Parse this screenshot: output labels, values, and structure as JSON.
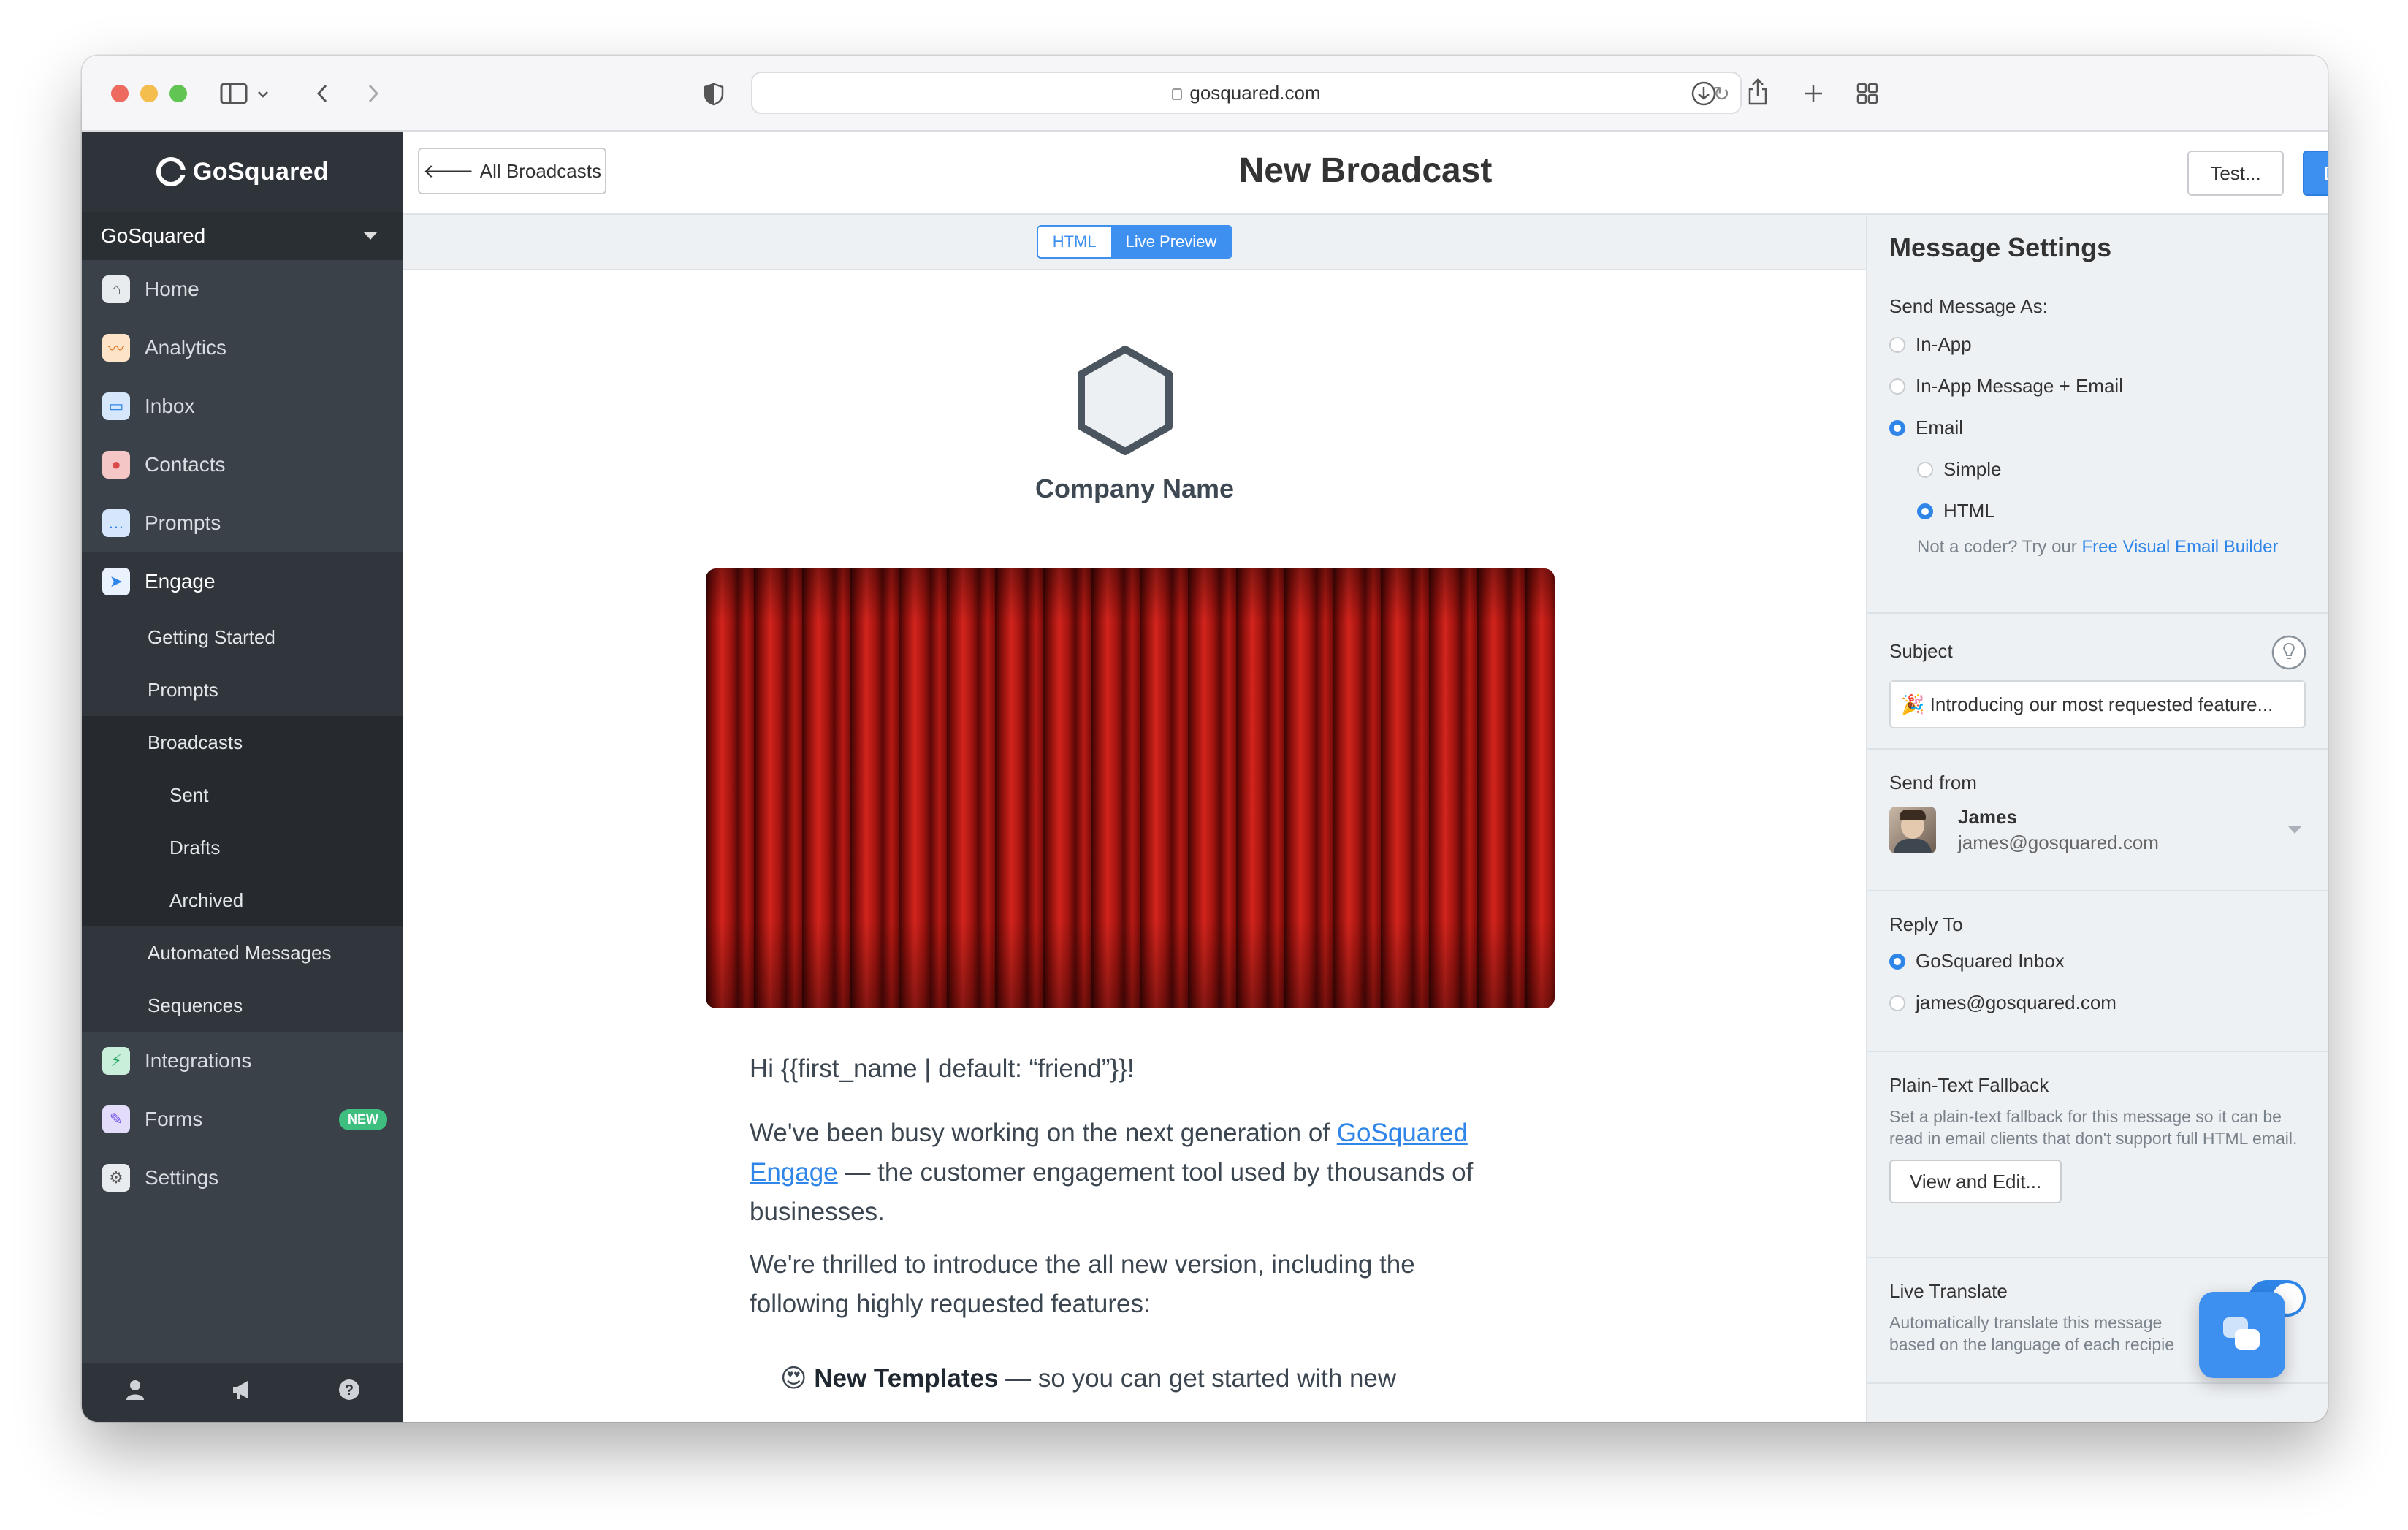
{
  "browser": {
    "url": "gosquared.com"
  },
  "sidebar": {
    "brand": "GoSquared",
    "project": "GoSquared",
    "items": [
      {
        "label": "Home",
        "icon": "home-icon",
        "color": "#9aa3ad"
      },
      {
        "label": "Analytics",
        "icon": "analytics-icon",
        "color": "#f0a35b"
      },
      {
        "label": "Inbox",
        "icon": "inbox-icon",
        "color": "#3d8ff0"
      },
      {
        "label": "Contacts",
        "icon": "contacts-icon",
        "color": "#e86464"
      },
      {
        "label": "Prompts",
        "icon": "prompts-icon",
        "color": "#3d8ff0"
      },
      {
        "label": "Engage",
        "icon": "engage-icon",
        "color": "#ffffff"
      }
    ],
    "engage_sub": [
      "Getting Started",
      "Prompts",
      "Broadcasts",
      "Sent",
      "Drafts",
      "Archived",
      "Automated Messages",
      "Sequences"
    ],
    "items_after": [
      {
        "label": "Integrations",
        "icon": "integrations-icon",
        "color": "#3fbf7f"
      },
      {
        "label": "Forms",
        "icon": "forms-icon",
        "color": "#8b6cf0",
        "badge": "NEW"
      },
      {
        "label": "Settings",
        "icon": "settings-icon",
        "color": "#9aa3ad"
      }
    ]
  },
  "header": {
    "back_label": "All Broadcasts",
    "title": "New Broadcast",
    "test_label": "Test...",
    "done_label": "Done"
  },
  "editor": {
    "mode_html": "HTML",
    "mode_preview": "Live Preview",
    "company_name": "Company Name",
    "greeting": "Hi {{first_name | default: “friend”}}!",
    "p1_before": "We've been busy working on the next generation of ",
    "p1_link": "GoSquared Engage",
    "p1_after": " — the customer engagement tool used by thousands of businesses.",
    "p2": "We're thrilled to introduce the all new version, including the following highly requested features:",
    "bullet_emoji": "😍",
    "bullet_bold": "New Templates",
    "bullet_rest": " — so you can get started with new"
  },
  "settings": {
    "title": "Message Settings",
    "send_as_label": "Send Message As:",
    "opt_inapp": "In-App",
    "opt_inapp_email": "In-App Message + Email",
    "opt_email": "Email",
    "opt_simple": "Simple",
    "opt_html": "HTML",
    "coder_note": "Not a coder? Try our ",
    "coder_link": "Free Visual Email Builder",
    "subject_label": "Subject",
    "subject_value": "🎉 Introducing our most requested feature...",
    "send_from_label": "Send from",
    "sender_name": "James",
    "sender_email": "james@gosquared.com",
    "reply_to_label": "Reply To",
    "reply_inbox": "GoSquared Inbox",
    "reply_email": "james@gosquared.com",
    "fallback_label": "Plain-Text Fallback",
    "fallback_desc": "Set a plain-text fallback for this message so it can be read in email clients that don't support full HTML email.",
    "fallback_button": "View and Edit...",
    "translate_label": "Live Translate",
    "translate_desc": "Automatically translate this message based on the language of each recipie"
  }
}
